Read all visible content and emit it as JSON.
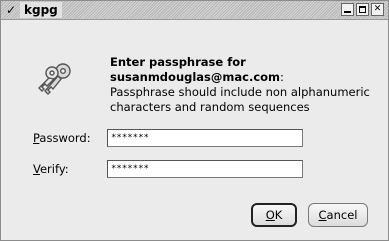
{
  "window": {
    "title": "kgpg",
    "menu_icon": "chevron-down-icon",
    "buttons": {
      "minimize": "minimize-icon",
      "maximize": "maximize-icon",
      "close_glyph": "✕"
    }
  },
  "message": {
    "heading": "Enter passphrase for",
    "account": "susanmdouglas@mac.com",
    "account_suffix": ":",
    "hint": "Passphrase should include non alphanumeric characters and random sequences"
  },
  "form": {
    "password_label_mnemonic": "P",
    "password_label_rest": "assword:",
    "password_value": "*******",
    "verify_label_mnemonic": "V",
    "verify_label_rest": "erify:",
    "verify_value": "*******"
  },
  "actions": {
    "ok_mnemonic": "O",
    "ok_rest": "K",
    "cancel_mnemonic": "C",
    "cancel_rest": "ancel"
  },
  "icons": {
    "dialog_icon": "keys-icon"
  }
}
